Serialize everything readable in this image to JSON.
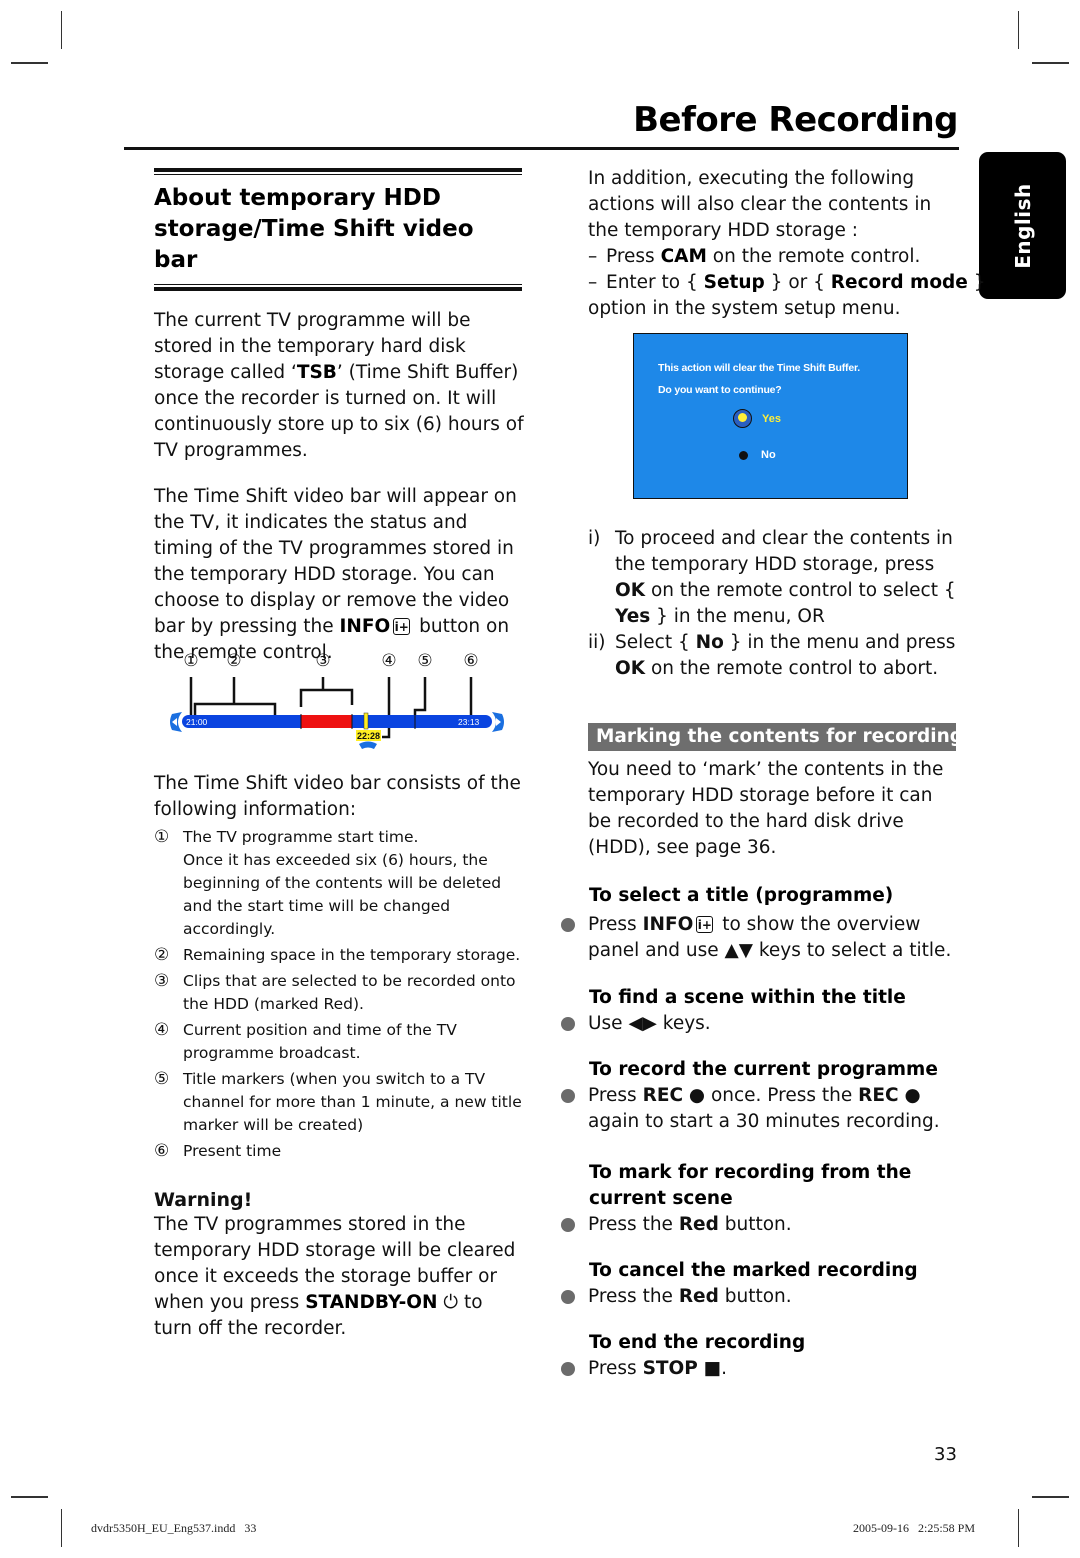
{
  "page": {
    "title": "Before Recording",
    "language_tab": "English",
    "page_number": "33",
    "slug_file": "dvdr5350H_EU_Eng537.indd   33",
    "slug_timestamp": "2005-09-16   2:25:58 PM"
  },
  "left": {
    "section_heading_line1": "About temporary HDD",
    "section_heading_line2": "storage/Time Shift video bar",
    "para1": {
      "pre": "The current TV programme will be stored in the temporary hard disk storage called ‘",
      "bold": "TSB",
      "post": "’ (Time Shift Buffer) once the recorder is turned on. It will continuously store up to six (6) hours of TV programmes."
    },
    "para2": {
      "pre": "The Time Shift video bar will appear on the TV, it indicates the status and timing of the TV programmes stored in the temporary HDD storage. You can choose to display or remove the video bar by pressing the ",
      "bold": "INFO",
      "icon": "i+",
      "post": " button on the remote control."
    },
    "timebar": {
      "callouts": [
        "①",
        "②",
        "③",
        "④",
        "⑤",
        "⑥"
      ],
      "start_time": "21:00",
      "current_time": "22:28",
      "present_time": "23:13",
      "colors": {
        "bar": "#0a44e0",
        "marked": "#ee1111",
        "current_marker": "#ffee22",
        "arrow": "#1a6fe0"
      }
    },
    "para3": "The Time Shift video bar consists of the following information:",
    "legend": [
      {
        "num": "①",
        "text": "The TV programme start time.",
        "extra": "Once it has exceeded six (6) hours, the beginning of the contents will be deleted and the start time will be changed accordingly."
      },
      {
        "num": "②",
        "text": "Remaining space in the temporary storage."
      },
      {
        "num": "③",
        "text": "Clips that are selected to be recorded onto the HDD (marked Red)."
      },
      {
        "num": "④",
        "text": "Current position and time of the TV programme broadcast."
      },
      {
        "num": "⑤",
        "text": "Title markers (when you switch to a TV channel for more than 1 minute, a new title marker will be created)"
      },
      {
        "num": "⑥",
        "text": "Present time"
      }
    ],
    "warning": {
      "heading": "Warning!",
      "pre": "The TV programmes stored in the temporary HDD storage will be cleared once it exceeds the storage buffer or when you press ",
      "bold": "STANDBY-ON",
      "icon": "⏻",
      "post": " to turn off the recorder."
    }
  },
  "right": {
    "intro": "In addition, executing the following actions will also clear the contents in the temporary HDD storage :",
    "dash1": {
      "dash": "–",
      "pre": "Press ",
      "bold": "CAM",
      "post": " on the remote control."
    },
    "dash2": {
      "dash": "–",
      "pre": "Enter to { ",
      "bold1": "Setup",
      "mid": " } or { ",
      "bold2": "Record mode",
      "post": " }"
    },
    "dash2_cont": "option in the system setup menu.",
    "dialog": {
      "line1": "This action will clear the Time Shift Buffer.",
      "line2": "Do you want to continue?",
      "yes": "Yes",
      "no": "No",
      "bg_color": "#1e88e8",
      "yes_color": "#ffef3a"
    },
    "steps": [
      {
        "n": "i)",
        "pre": "To proceed and clear the contents in the temporary HDD storage, press ",
        "b1": "OK",
        "mid": " on the remote control to select { ",
        "b2": "Yes",
        "post": " } in the menu, OR"
      },
      {
        "n": "ii)",
        "pre": "Select { ",
        "b1": "No",
        "mid": " } in the menu and press ",
        "b2": "OK",
        "post": " on the remote control to abort."
      }
    ],
    "marking_heading": "Marking the contents for recording",
    "marking_para": "You need to ‘mark’ the contents in the temporary HDD storage before it can be recorded to the hard disk drive (HDD), see page 36.",
    "tasks": [
      {
        "heading": "To select a title (programme)",
        "pre": "Press ",
        "bold": "INFO",
        "icon": "i+",
        "post": " to show the overview panel and use ▲▼ keys to select a title."
      },
      {
        "heading": "To find a scene within the title",
        "pre": "Use ◀▶ keys."
      },
      {
        "heading": "To record the current programme",
        "pre": "Press ",
        "bold": "REC",
        "mid": " ● once. Press the ",
        "bold2": "REC",
        "post": " ● again to start a 30 minutes recording."
      },
      {
        "heading": "To mark for recording from the current scene",
        "pre": "Press the ",
        "bold": "Red",
        "post": " button."
      },
      {
        "heading": "To cancel the marked recording",
        "pre": "Press the ",
        "bold": "Red",
        "post": " button."
      },
      {
        "heading": "To end the recording",
        "pre": "Press ",
        "bold": "STOP",
        "post": " ■."
      }
    ]
  }
}
